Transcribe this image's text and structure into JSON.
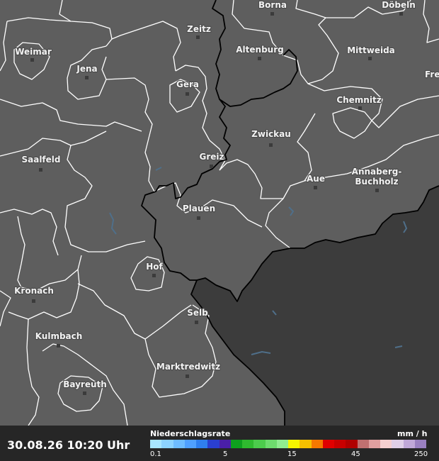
{
  "map": {
    "cities": [
      {
        "name": "Borna"
      },
      {
        "name": "Döbeln"
      },
      {
        "name": "Zeitz"
      },
      {
        "name": "Weimar"
      },
      {
        "name": "Altenburg"
      },
      {
        "name": "Mittweida"
      },
      {
        "name": "Jena"
      },
      {
        "name": "Frei"
      },
      {
        "name": "Gera"
      },
      {
        "name": "Chemnitz"
      },
      {
        "name": "Zwickau"
      },
      {
        "name": "Saalfeld"
      },
      {
        "name": "Greiz"
      },
      {
        "name": "Annaberg-"
      },
      {
        "name": "Buchholz"
      },
      {
        "name": "Aue"
      },
      {
        "name": "Plauen"
      },
      {
        "name": "Hof"
      },
      {
        "name": "Kronach"
      },
      {
        "name": "Selb"
      },
      {
        "name": "Kulmbach"
      },
      {
        "name": "Marktredwitz"
      },
      {
        "name": "Bayreuth"
      }
    ],
    "colors": {
      "land": "#5e5e5e",
      "foreign_territory": "#3c3c3c",
      "district_border": "#ffffff",
      "state_border": "#000000",
      "water": "#4f6f8a"
    }
  },
  "bottom_bar": {
    "timestamp": "30.08.26 10:20 Uhr",
    "legend_title": "Niederschlagsrate",
    "legend_unit": "mm / h",
    "ticks": [
      "0.1",
      "5",
      "15",
      "45",
      "250"
    ],
    "scale_colors": [
      "#a8e6ff",
      "#8cd3ff",
      "#6ebcff",
      "#4fa0ff",
      "#2f7fef",
      "#2a3fd0",
      "#4a1fa8",
      "#0ea01e",
      "#2fba2f",
      "#4ccc4c",
      "#6ddc6d",
      "#90ec90",
      "#f5f500",
      "#f5c000",
      "#f57800",
      "#e00000",
      "#c80000",
      "#b00000",
      "#c07070",
      "#e0a0a0",
      "#f5d0d0",
      "#e0d0e8",
      "#c0a8d8",
      "#9a80c0"
    ]
  }
}
